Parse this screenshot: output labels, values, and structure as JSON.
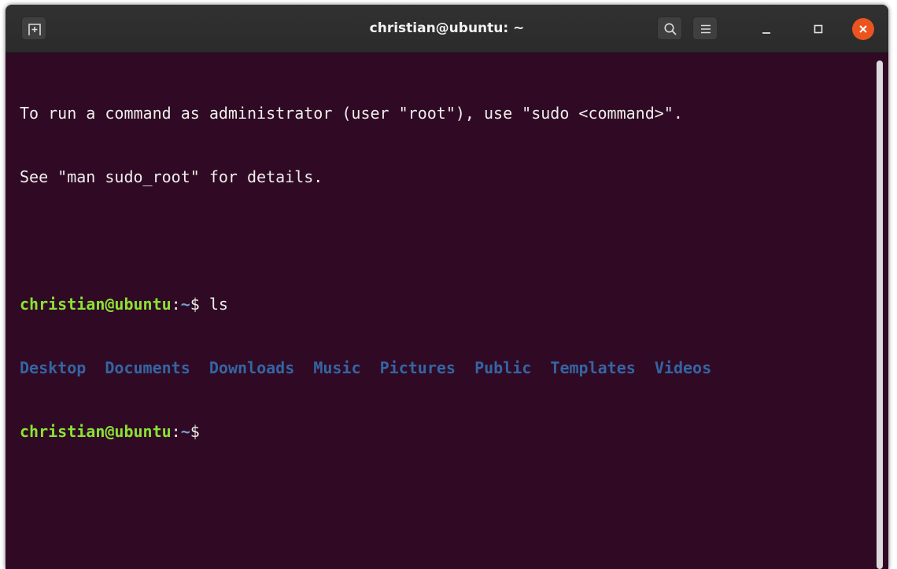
{
  "window": {
    "title": "christian@ubuntu: ~"
  },
  "colors": {
    "terminal_bg": "#300a24",
    "prompt_user": "#8ae234",
    "prompt_path": "#729fcf",
    "directory": "#3465a4",
    "close_button": "#e9541f"
  },
  "headerbar": {
    "new_tab_icon": "new-tab-icon",
    "search_icon": "search-icon",
    "menu_icon": "hamburger-menu-icon",
    "minimize_icon": "minimize-icon",
    "maximize_icon": "maximize-icon",
    "close_icon": "close-icon"
  },
  "terminal": {
    "line1": "To run a command as administrator (user \"root\"), use \"sudo <command>\".",
    "line2": "See \"man sudo_root\" for details.",
    "prompt1": {
      "user_host": "christian@ubuntu",
      "colon": ":",
      "path": "~",
      "symbol": "$ ",
      "command": "ls"
    },
    "ls_output": [
      "Desktop",
      "Documents",
      "Downloads",
      "Music",
      "Pictures",
      "Public",
      "Templates",
      "Videos"
    ],
    "prompt2": {
      "user_host": "christian@ubuntu",
      "colon": ":",
      "path": "~",
      "symbol": "$"
    }
  }
}
